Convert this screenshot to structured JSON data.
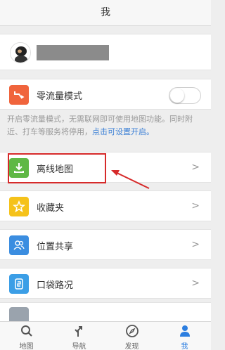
{
  "header": {
    "title": "我"
  },
  "zero_traffic": {
    "label": "零流量模式",
    "icon": "zero-traffic-icon",
    "icon_color": "#f0643c",
    "toggle_on": false
  },
  "description": {
    "text": "开启零流量模式，无需联网即可使用地图功能。同时附近、打车等服务将停用，",
    "link": "点击可设置开启。"
  },
  "menu": {
    "items": [
      {
        "label": "离线地图",
        "icon": "download-icon",
        "icon_color": "#5fb845"
      },
      {
        "label": "收藏夹",
        "icon": "star-icon",
        "icon_color": "#f5c21a"
      },
      {
        "label": "位置共享",
        "icon": "people-icon",
        "icon_color": "#3b8de0"
      },
      {
        "label": "口袋路况",
        "icon": "phone-traffic-icon",
        "icon_color": "#3b9ee6"
      }
    ]
  },
  "tabbar": {
    "tabs": [
      {
        "label": "地图",
        "icon": "search-icon"
      },
      {
        "label": "导航",
        "icon": "navigation-icon"
      },
      {
        "label": "发现",
        "icon": "compass-icon"
      },
      {
        "label": "我",
        "icon": "user-icon",
        "active": true
      }
    ]
  },
  "colors": {
    "accent": "#2c7ee0",
    "highlight": "#d62a2a"
  }
}
